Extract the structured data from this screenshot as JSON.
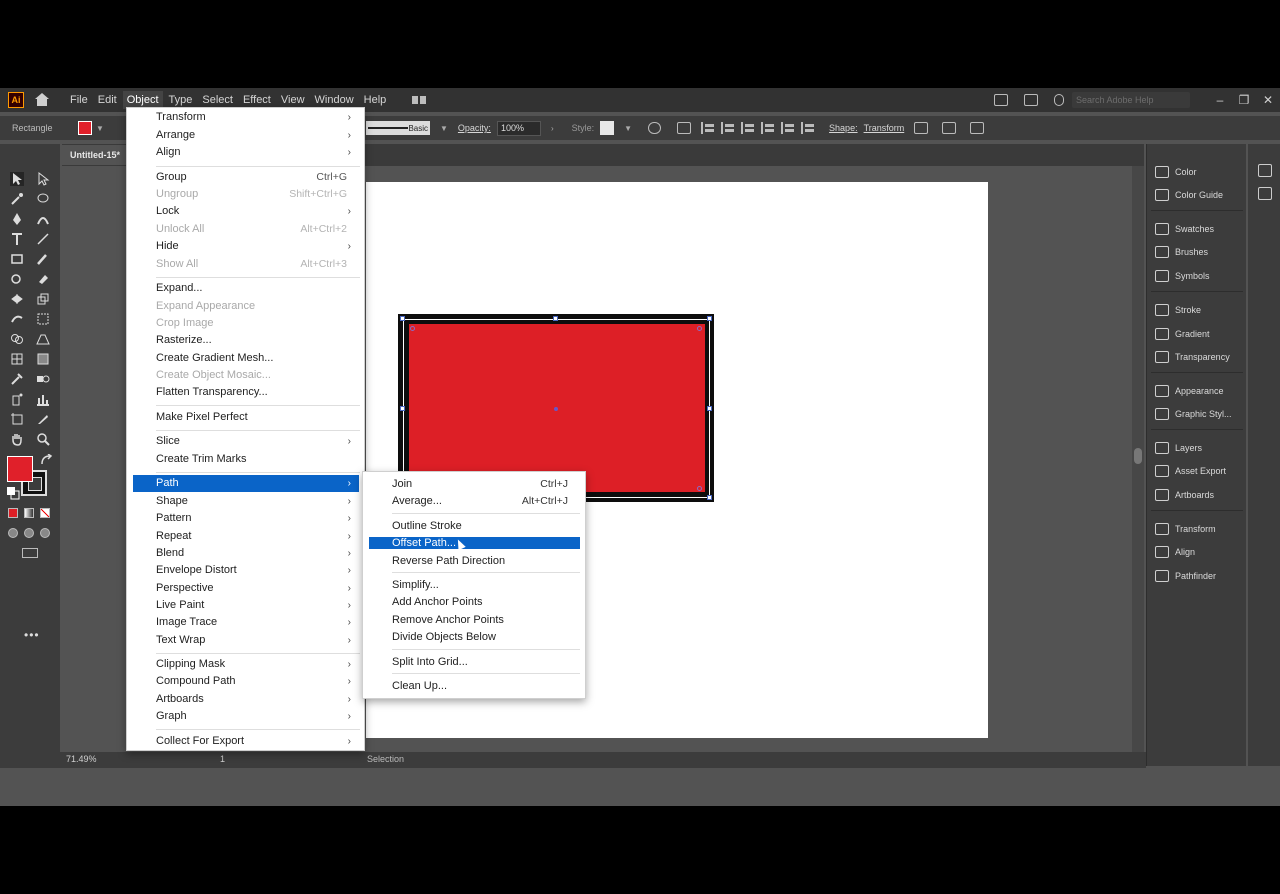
{
  "menubar": {
    "logo": "Ai",
    "items": [
      "File",
      "Edit",
      "Object",
      "Type",
      "Select",
      "Effect",
      "View",
      "Window",
      "Help"
    ],
    "search_placeholder": "Search Adobe Help"
  },
  "controlbar": {
    "tool_label": "Rectangle",
    "stroke_style": "Basic",
    "opacity_label": "Opacity:",
    "opacity_value": "100%",
    "style_label": "Style:",
    "shape_label": "Shape:",
    "transform_label": "Transform"
  },
  "document": {
    "tab_title": "Untitled-15*"
  },
  "status": {
    "zoom": "71.49%",
    "artboard": "1",
    "tool": "Selection"
  },
  "right_panels": {
    "group1": [
      "Color",
      "Color Guide"
    ],
    "group2": [
      "Swatches",
      "Brushes",
      "Symbols"
    ],
    "group3": [
      "Stroke",
      "Gradient",
      "Transparency"
    ],
    "group4": [
      "Appearance",
      "Graphic Styl..."
    ],
    "group5": [
      "Layers",
      "Asset Export",
      "Artboards"
    ],
    "group6": [
      "Transform",
      "Align",
      "Pathfinder"
    ]
  },
  "object_menu": {
    "transform": "Transform",
    "arrange": "Arrange",
    "align": "Align",
    "group": "Group",
    "group_sc": "Ctrl+G",
    "ungroup": "Ungroup",
    "ungroup_sc": "Shift+Ctrl+G",
    "lock": "Lock",
    "unlock_all": "Unlock All",
    "unlock_all_sc": "Alt+Ctrl+2",
    "hide": "Hide",
    "show_all": "Show All",
    "show_all_sc": "Alt+Ctrl+3",
    "expand": "Expand...",
    "expand_appearance": "Expand Appearance",
    "crop_image": "Crop Image",
    "rasterize": "Rasterize...",
    "create_gradient_mesh": "Create Gradient Mesh...",
    "create_object_mosaic": "Create Object Mosaic...",
    "flatten_transparency": "Flatten Transparency...",
    "make_pixel_perfect": "Make Pixel Perfect",
    "slice": "Slice",
    "create_trim_marks": "Create Trim Marks",
    "path": "Path",
    "shape": "Shape",
    "pattern": "Pattern",
    "repeat": "Repeat",
    "blend": "Blend",
    "envelope_distort": "Envelope Distort",
    "perspective": "Perspective",
    "live_paint": "Live Paint",
    "image_trace": "Image Trace",
    "text_wrap": "Text Wrap",
    "clipping_mask": "Clipping Mask",
    "compound_path": "Compound Path",
    "artboards": "Artboards",
    "graph": "Graph",
    "collect_for_export": "Collect For Export"
  },
  "path_submenu": {
    "join": "Join",
    "join_sc": "Ctrl+J",
    "average": "Average...",
    "average_sc": "Alt+Ctrl+J",
    "outline_stroke": "Outline Stroke",
    "offset_path": "Offset Path...",
    "reverse_path_direction": "Reverse Path Direction",
    "simplify": "Simplify...",
    "add_anchor_points": "Add Anchor Points",
    "remove_anchor_points": "Remove Anchor Points",
    "divide_objects_below": "Divide Objects Below",
    "split_into_grid": "Split Into Grid...",
    "clean_up": "Clean Up..."
  },
  "colors": {
    "fill": "#dd1f26",
    "stroke": "#0d0d0d",
    "menu_highlight": "#0a64c8",
    "ui_background": "#535353"
  }
}
